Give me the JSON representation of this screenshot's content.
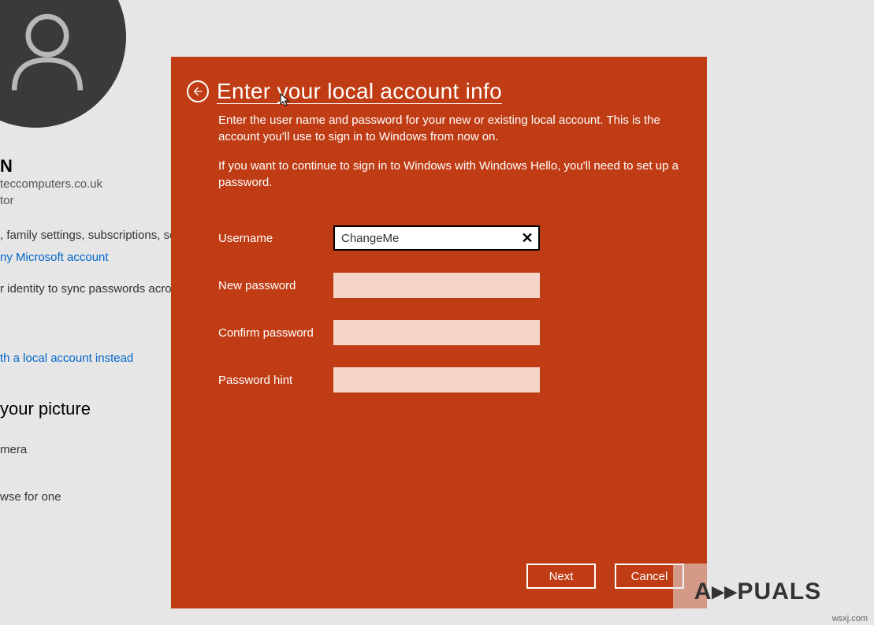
{
  "background": {
    "username_partial": "N",
    "email_partial": "teccomputers.co.uk",
    "role_partial": "tor",
    "info_line_partial": ", family settings, subscriptions, sec",
    "ms_account_link_partial": "ny Microsoft account",
    "identity_line_partial": "r identity to sync passwords across",
    "local_account_link_partial": "th a local account instead",
    "picture_heading_partial": "your picture",
    "camera_partial": "mera",
    "browse_partial": "wse for one"
  },
  "modal": {
    "title": "Enter your local account info",
    "description1": "Enter the user name and password for your new or existing local account. This is the account you'll use to sign in to Windows from now on.",
    "description2": "If you want to continue to sign in to Windows with Windows Hello, you'll need to set up a password.",
    "fields": {
      "username_label": "Username",
      "username_value": "ChangeMe",
      "new_password_label": "New password",
      "new_password_value": "",
      "confirm_password_label": "Confirm password",
      "confirm_password_value": "",
      "password_hint_label": "Password hint",
      "password_hint_value": ""
    },
    "buttons": {
      "next": "Next",
      "cancel": "Cancel"
    }
  },
  "watermark": {
    "brand": "A▸▸PUALS",
    "corner": "wsxj.com"
  }
}
